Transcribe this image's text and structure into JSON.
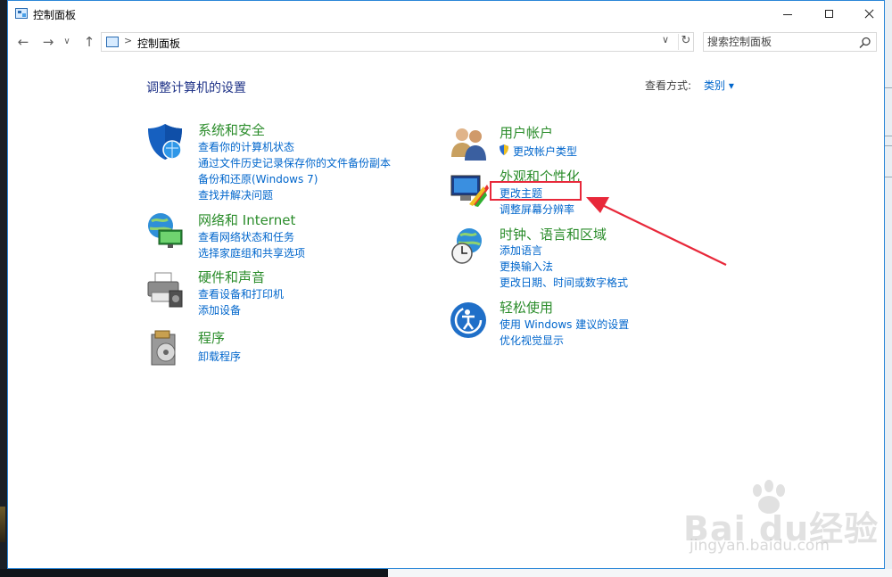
{
  "window": {
    "title": "控制面板"
  },
  "nav": {
    "address_path": "控制面板",
    "address_sep": ">",
    "search_placeholder": "搜索控制面板",
    "back_glyph": "←",
    "forward_glyph": "→",
    "recent_glyph": "∨",
    "up_glyph": "↑",
    "dropdown_glyph": "∨",
    "refresh_glyph": "↻"
  },
  "main": {
    "heading": "调整计算机的设置",
    "view_by_label": "查看方式:",
    "view_by_value": "类别 ▾"
  },
  "categories": [
    {
      "title": "系统和安全",
      "icon": "shield-icon",
      "links": [
        "查看你的计算机状态",
        "通过文件历史记录保存你的文件备份副本",
        "备份和还原(Windows 7)",
        "查找并解决问题"
      ]
    },
    {
      "title": "网络和 Internet",
      "icon": "network-globe-icon",
      "links": [
        "查看网络状态和任务",
        "选择家庭组和共享选项"
      ]
    },
    {
      "title": "硬件和声音",
      "icon": "printer-icon",
      "links": [
        "查看设备和打印机",
        "添加设备"
      ]
    },
    {
      "title": "程序",
      "icon": "programs-icon",
      "links": [
        "卸载程序"
      ]
    },
    {
      "title": "用户帐户",
      "icon": "users-icon",
      "links": [
        "更改帐户类型"
      ]
    },
    {
      "title": "外观和个性化",
      "icon": "appearance-monitor-icon",
      "links": [
        "更改主题",
        "调整屏幕分辨率"
      ]
    },
    {
      "title": "时钟、语言和区域",
      "icon": "clock-globe-icon",
      "links": [
        "添加语言",
        "更换输入法",
        "更改日期、时间或数字格式"
      ]
    },
    {
      "title": "轻松使用",
      "icon": "ease-of-access-icon",
      "links": [
        "使用 Windows 建议的设置",
        "优化视觉显示"
      ]
    }
  ],
  "watermark": {
    "text": "Bai du经验",
    "url": "jingyan.baidu.com"
  },
  "colors": {
    "heading": "#1e3287",
    "category_title": "#2a8c2a",
    "link": "#0066cc",
    "highlight": "#e8283a",
    "window_border": "#2b87d8"
  }
}
